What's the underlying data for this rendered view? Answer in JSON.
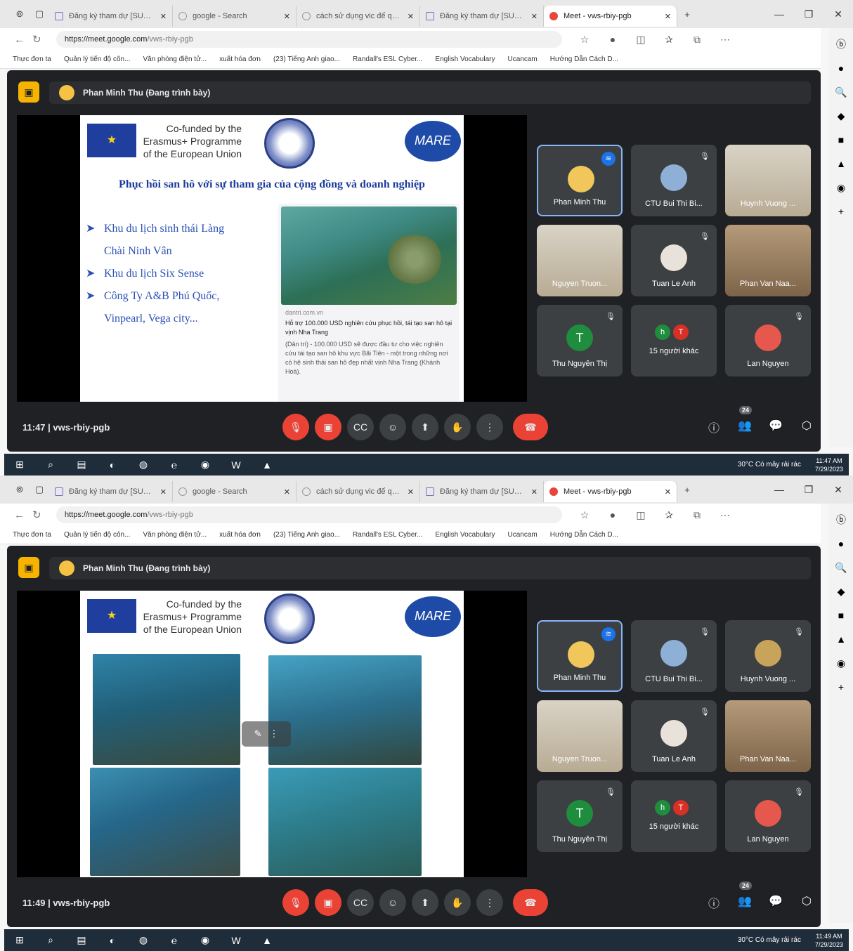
{
  "shots": [
    {
      "tabs": [
        "Đăng ký tham dự [SUMAR",
        "google - Search",
        "cách sử dụng vic để quay -",
        "Đăng ký tham dự [SUMAR",
        "Meet - vws-rbiy-pgb"
      ],
      "url_host": "https://meet.google.com",
      "url_path": "/vws-rbiy-pgb",
      "bookmarks": [
        "Thực đơn ta",
        "Quản lý tiến độ côn...",
        "Văn phòng điện tử...",
        "xuất hóa đơn",
        "(23) Tiếng Anh giao...",
        "Randall's ESL Cyber...",
        "English Vocabulary",
        "Ucancam",
        "Hướng Dẫn Cách D..."
      ],
      "presenter": "Phan Minh Thu (Đang trình bày)",
      "time": "11:47",
      "meeting_code": "vws-rbiy-pgb",
      "participant_count": "24",
      "tiles": [
        "Phan Minh Thu",
        "CTU Bui Thi Bi...",
        "Huynh Vuong ...",
        "Nguyen Truon...",
        "Tuan Le Anh",
        "Phan Van Naa...",
        "Thu Nguyễn Thị",
        "15 người khác",
        "Lan Nguyen"
      ],
      "taskbar_weather": "30°C Có mây rải rác",
      "clock_time": "11:47 AM",
      "clock_date": "7/29/2023"
    },
    {
      "tabs": [
        "Đăng ký tham dự [SUMAR",
        "google - Search",
        "cách sử dụng vic để quay -",
        "Đăng ký tham dự [SUMAR",
        "Meet - vws-rbiy-pgb"
      ],
      "url_host": "https://meet.google.com",
      "url_path": "/vws-rbiy-pgb",
      "bookmarks": [
        "Thực đơn ta",
        "Quản lý tiến độ côn...",
        "Văn phòng điện tử...",
        "xuất hóa đơn",
        "(23) Tiếng Anh giao...",
        "Randall's ESL Cyber...",
        "English Vocabulary",
        "Ucancam",
        "Hướng Dẫn Cách D..."
      ],
      "presenter": "Phan Minh Thu (Đang trình bày)",
      "time": "11:49",
      "meeting_code": "vws-rbiy-pgb",
      "participant_count": "24",
      "tiles": [
        "Phan Minh Thu",
        "CTU Bui Thi Bi...",
        "Huynh Vuong ...",
        "Nguyen Truon...",
        "Tuan Le Anh",
        "Phan Van Naa...",
        "Thu Nguyễn Thị",
        "15 người khác",
        "Lan Nguyen"
      ],
      "taskbar_weather": "30°C Có mây rải rác",
      "clock_time": "11:49 AM",
      "clock_date": "7/29/2023"
    }
  ],
  "slide": {
    "cofund": [
      "Co-funded by the",
      "Erasmus+ Programme",
      "of the European Union"
    ],
    "mare": "MARE",
    "title": "Phục hồi san hô với sự tham gia của cộng đồng và doanh nghiệp",
    "bullets": [
      {
        "line1": "Khu du lịch sinh thái Làng",
        "line2": "Chài Ninh Vân"
      },
      {
        "line1": "Khu du lịch Six Sense",
        "line2": ""
      },
      {
        "line1": "Công Ty A&B Phú Quốc,",
        "line2": "Vinpearl, Vega city..."
      }
    ],
    "card": {
      "domain": "dantri.com.vn",
      "headline": "Hỗ trợ 100.000 USD nghiên cứu phục hồi, tái tạo san hô tại vịnh Nha Trang",
      "body": "(Dân trí) - 100.000 USD sẽ được đầu tư cho việc nghiên cứu tái tạo san hô khu vực Bãi Tiên - một trong những nơi có hệ sinh thái san hô đẹp nhất vịnh Nha Trang (Khánh Hoà)."
    }
  },
  "colors": {
    "meet_bg": "#202124",
    "tile_bg": "#3c4043",
    "red": "#ea4335",
    "accent": "#8ab4f8"
  }
}
